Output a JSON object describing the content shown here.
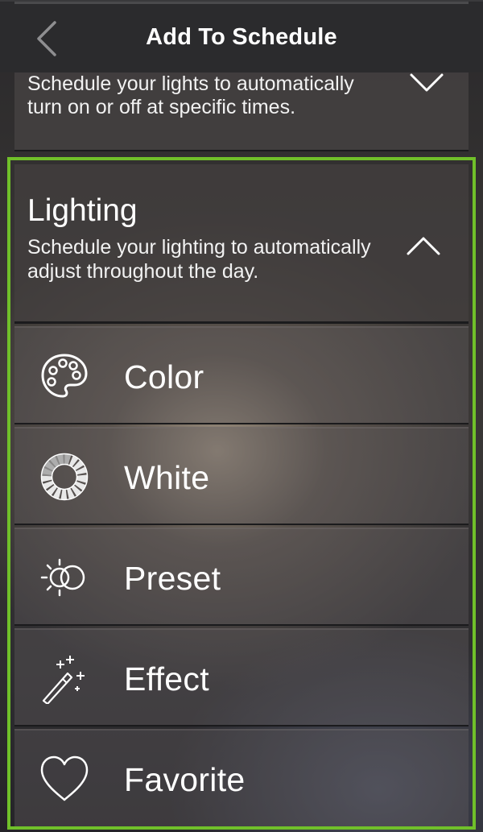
{
  "header": {
    "title": "Add To Schedule",
    "back_icon": "chevron-left-icon"
  },
  "schedule_section": {
    "description": "Schedule your lights to automatically turn on or off at specific times.",
    "toggle_icon": "chevron-down-icon"
  },
  "lighting_section": {
    "title": "Lighting",
    "description": "Schedule your lighting to automatically adjust throughout the day.",
    "toggle_icon": "chevron-up-icon",
    "highlight_color": "#70c02a",
    "items": [
      {
        "label": "Color",
        "icon": "palette-icon"
      },
      {
        "label": "White",
        "icon": "white-wheel-icon"
      },
      {
        "label": "Preset",
        "icon": "preset-sun-icon"
      },
      {
        "label": "Effect",
        "icon": "magic-wand-icon"
      },
      {
        "label": "Favorite",
        "icon": "heart-icon"
      }
    ]
  }
}
